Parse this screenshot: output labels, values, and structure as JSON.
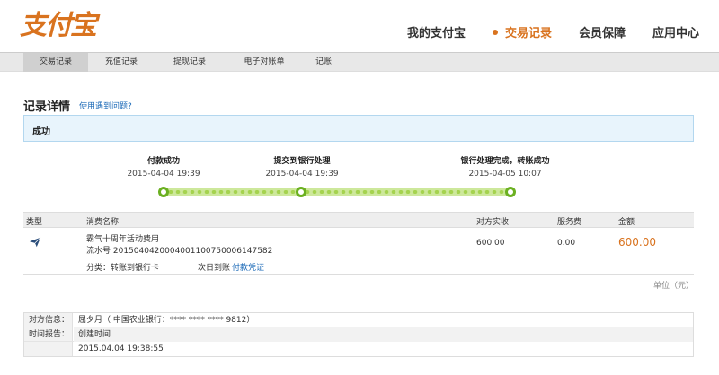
{
  "logo": {
    "text": "支付宝"
  },
  "topnav": [
    {
      "label": "我的支付宝"
    },
    {
      "label": "交易记录"
    },
    {
      "label": "会员保障"
    },
    {
      "label": "应用中心"
    }
  ],
  "subnav": [
    {
      "label": "交易记录"
    },
    {
      "label": "充值记录"
    },
    {
      "label": "提现记录"
    },
    {
      "label": "电子对账单"
    },
    {
      "label": "记账"
    }
  ],
  "page": {
    "title": "记录详情",
    "help_link": "使用遇到问题?"
  },
  "status": {
    "text": "成功"
  },
  "timeline": [
    {
      "title": "付款成功",
      "time": "2015-04-04 19:39"
    },
    {
      "title": "提交到银行处理",
      "time": "2015-04-04 19:39"
    },
    {
      "title": "银行处理完成，转账成功",
      "time": "2015-04-05 10:07"
    }
  ],
  "table": {
    "headers": {
      "type": "类型",
      "name": "消费名称",
      "counterparty_received": "对方实收",
      "fee": "服务费",
      "amount": "金额"
    },
    "row": {
      "name": "霸气十周年活动费用",
      "serial": "流水号 2015040420004001100750006147582",
      "counterparty_received": "600.00",
      "fee": "0.00",
      "amount": "600.00"
    },
    "detail": {
      "category": "分类：转账到银行卡",
      "arrival": "次日到账",
      "voucher": "付款凭证"
    }
  },
  "unit": "单位（元）",
  "info": {
    "counterparty_label": "对方信息：",
    "counterparty_value": "屈夕月（ 中国农业银行：**** **** **** 9812）",
    "time_label": "时间报告：",
    "time_sub_label": "创建时间",
    "time_value": "2015.04.04 19:38:55"
  },
  "colors": {
    "accent": "#d9731f",
    "link": "#1e6bb8",
    "progress": "#a5d34f",
    "status_bg": "#e8f4fc"
  }
}
